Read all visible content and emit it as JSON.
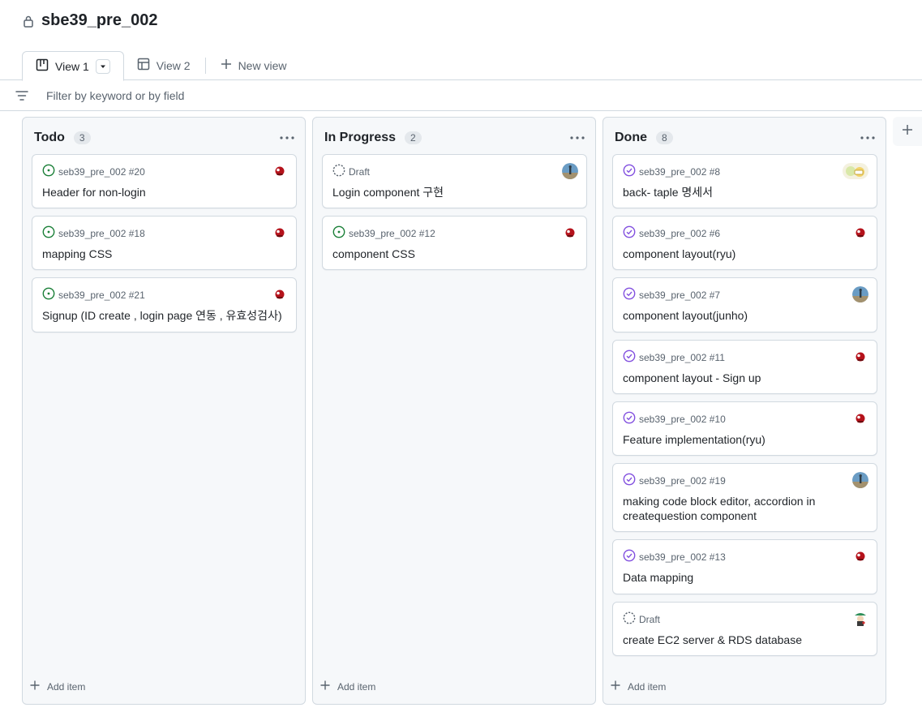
{
  "project": {
    "title": "sbe39_pre_002"
  },
  "views": [
    {
      "label": "View 1",
      "icon": "board-icon"
    },
    {
      "label": "View 2",
      "icon": "table-icon"
    },
    {
      "label": "New view",
      "icon": "plus-icon"
    }
  ],
  "filter": {
    "placeholder": "Filter by keyword or by field"
  },
  "columns": [
    {
      "name": "Todo",
      "count": "3",
      "cards": [
        {
          "meta": "seb39_pre_002 #20",
          "title": "Header for non-login",
          "status": "open",
          "avatar": "red-character-avatar"
        },
        {
          "meta": "seb39_pre_002 #18",
          "title": "mapping CSS",
          "status": "open",
          "avatar": "red-character-avatar"
        },
        {
          "meta": "seb39_pre_002 #21",
          "title": "Signup (ID create , login page 연동 , 유효성검사)",
          "status": "open",
          "avatar": "red-character-avatar"
        }
      ],
      "add_label": "Add item"
    },
    {
      "name": "In Progress",
      "count": "2",
      "cards": [
        {
          "meta": "Draft",
          "title": "Login component 구현",
          "status": "draft",
          "avatar": "blue-photo-avatar"
        },
        {
          "meta": "seb39_pre_002 #12",
          "title": "component CSS",
          "status": "open",
          "avatar": "red-character-avatar"
        }
      ],
      "add_label": "Add item"
    },
    {
      "name": "Done",
      "count": "8",
      "cards": [
        {
          "meta": "seb39_pre_002 #8",
          "title": "back- taple 명세서",
          "status": "done",
          "avatar": "yellow-cartoon-avatar"
        },
        {
          "meta": "seb39_pre_002 #6",
          "title": "component layout(ryu)",
          "status": "done",
          "avatar": "red-character-avatar"
        },
        {
          "meta": "seb39_pre_002 #7",
          "title": "component layout(junho)",
          "status": "done",
          "avatar": "blue-photo-avatar"
        },
        {
          "meta": "seb39_pre_002 #11",
          "title": "component layout - Sign up",
          "status": "done",
          "avatar": "red-character-avatar"
        },
        {
          "meta": "seb39_pre_002 #10",
          "title": "Feature implementation(ryu)",
          "status": "done",
          "avatar": "red-character-avatar"
        },
        {
          "meta": "seb39_pre_002 #19",
          "title": "making code block editor, accordion in createquestion component",
          "status": "done",
          "avatar": "blue-photo-avatar"
        },
        {
          "meta": "seb39_pre_002 #13",
          "title": "Data mapping",
          "status": "done",
          "avatar": "red-character-avatar"
        },
        {
          "meta": "Draft",
          "title": "create EC2 server & RDS database",
          "status": "draft",
          "avatar": "green-character-avatar"
        }
      ],
      "add_label": "Add item"
    }
  ],
  "colors": {
    "open": "#1a7f37",
    "done": "#8250df",
    "draft": "#59636e",
    "border": "#d1d9e0",
    "column_bg": "#f6f8fa"
  }
}
